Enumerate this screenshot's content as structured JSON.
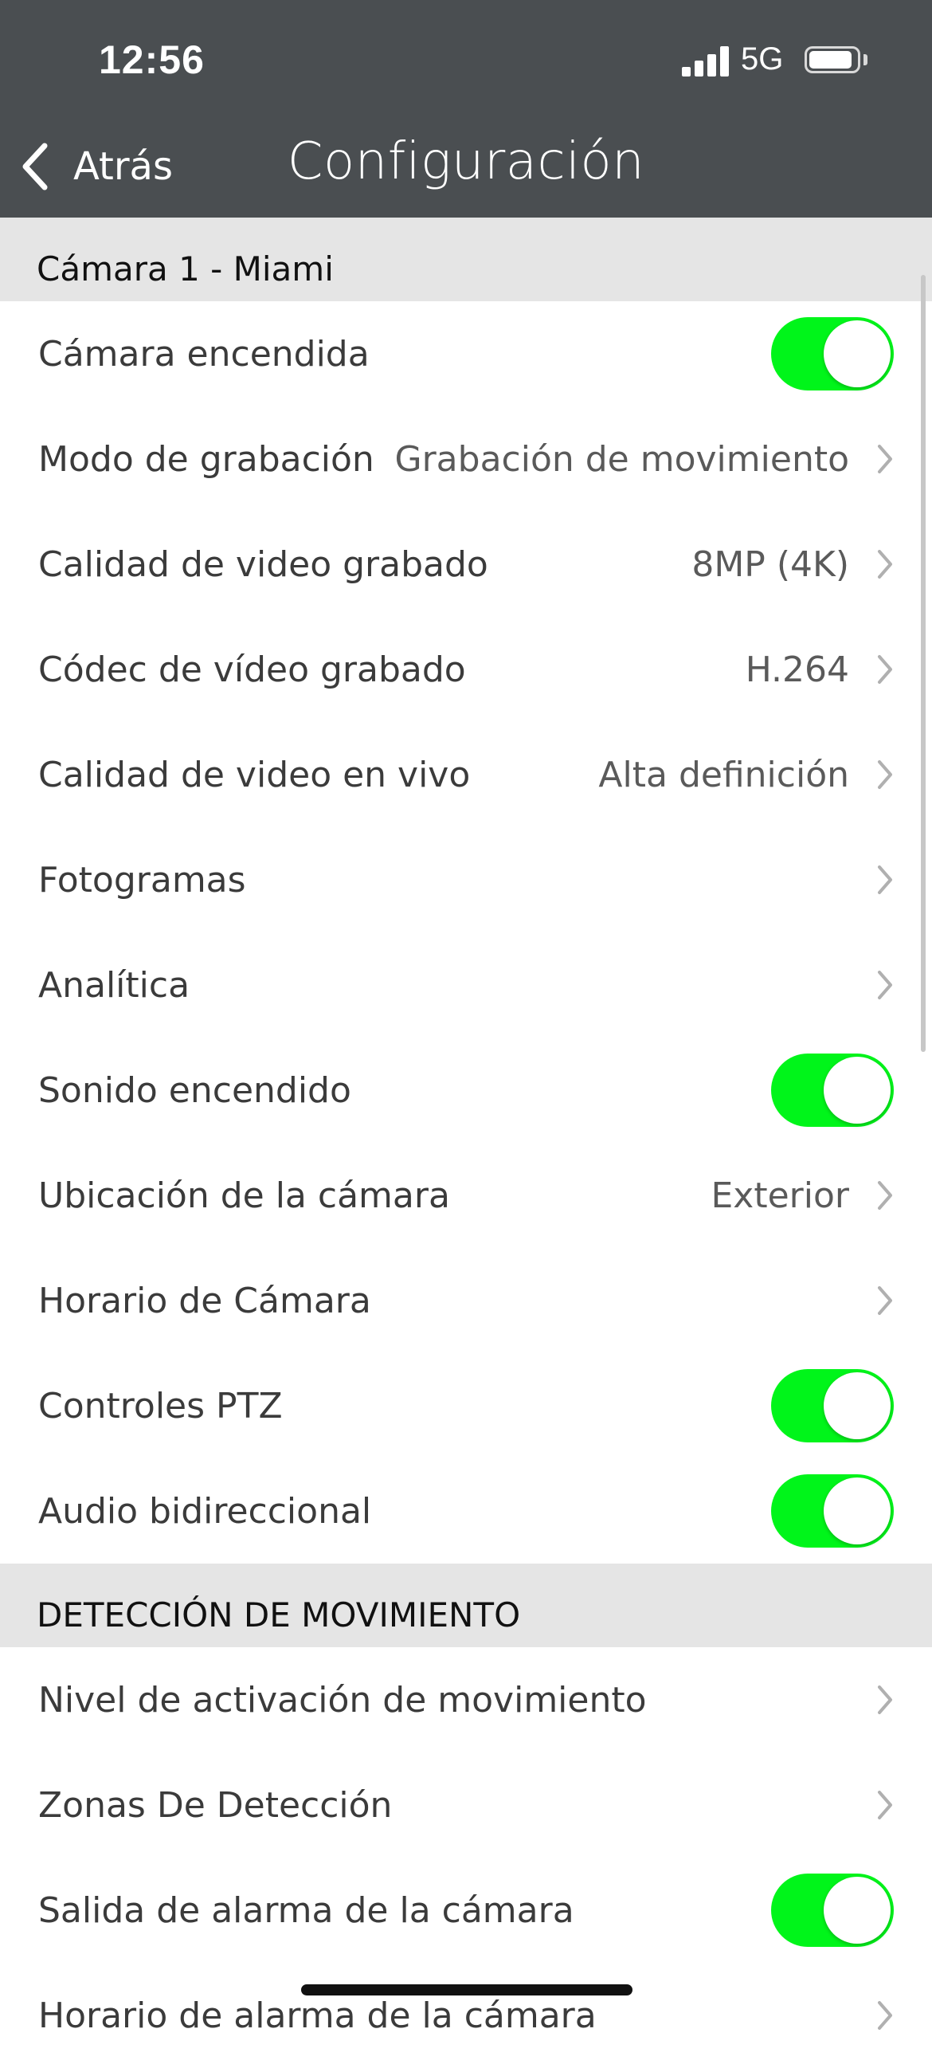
{
  "status_bar": {
    "time": "12:56",
    "network": "5G"
  },
  "nav": {
    "back_label": "Atrás",
    "title": "Configuración"
  },
  "sections": [
    {
      "header": "Cámara 1 - Miami",
      "rows": [
        {
          "label": "Cámara encendida",
          "type": "toggle",
          "on": true
        },
        {
          "label": "Modo de grabación",
          "type": "nav",
          "value": "Grabación de movimiento"
        },
        {
          "label": "Calidad de video grabado",
          "type": "nav",
          "value": "8MP (4K)"
        },
        {
          "label": "Códec de vídeo grabado",
          "type": "nav",
          "value": "H.264"
        },
        {
          "label": "Calidad de video en vivo",
          "type": "nav",
          "value": "Alta definición"
        },
        {
          "label": "Fotogramas",
          "type": "nav",
          "value": ""
        },
        {
          "label": "Analítica",
          "type": "nav",
          "value": ""
        },
        {
          "label": "Sonido encendido",
          "type": "toggle",
          "on": true
        },
        {
          "label": "Ubicación de la cámara",
          "type": "nav",
          "value": "Exterior"
        },
        {
          "label": "Horario de Cámara",
          "type": "nav",
          "value": ""
        },
        {
          "label": "Controles PTZ",
          "type": "toggle",
          "on": true
        },
        {
          "label": "Audio bidireccional",
          "type": "toggle",
          "on": true
        }
      ]
    },
    {
      "header": "DETECCIÓN DE MOVIMIENTO",
      "rows": [
        {
          "label": "Nivel de activación de movimiento",
          "type": "nav",
          "value": ""
        },
        {
          "label": "Zonas De Detección",
          "type": "nav",
          "value": ""
        },
        {
          "label": "Salida de alarma de la cámara",
          "type": "toggle",
          "on": true
        },
        {
          "label": "Horario de alarma de la cámara",
          "type": "nav",
          "value": ""
        }
      ]
    }
  ],
  "colors": {
    "bar": "#4a4e51",
    "toggle_on": "#00f51a",
    "section_bg": "#e5e5e5"
  },
  "icons": {
    "back": "chevron-left-icon",
    "disclosure": "chevron-right-icon"
  }
}
